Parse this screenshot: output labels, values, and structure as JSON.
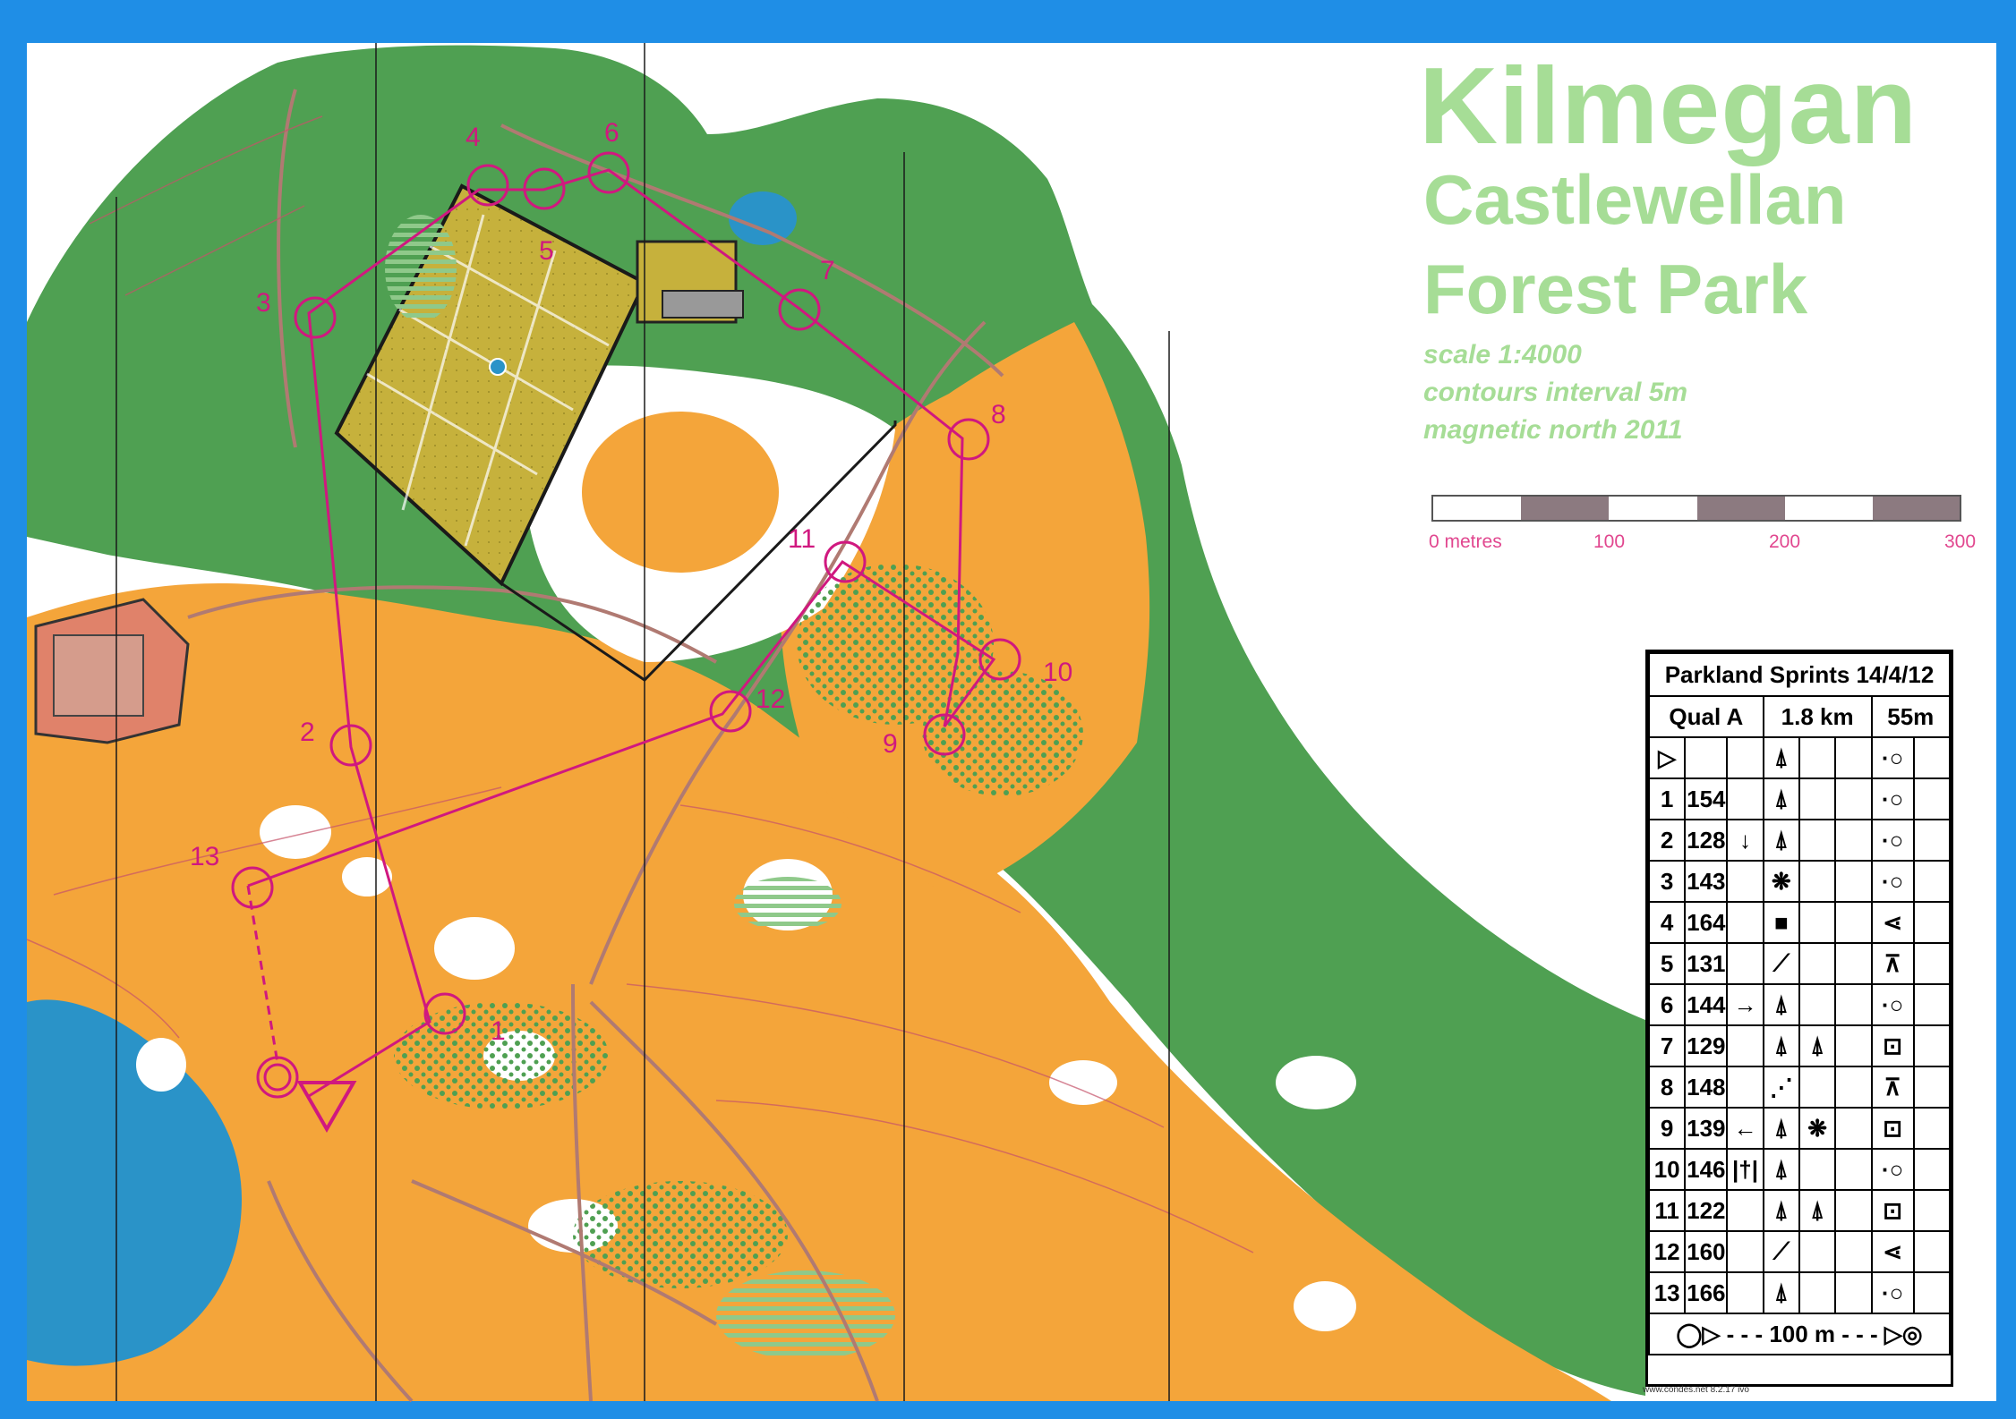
{
  "map": {
    "title_line1": "Kilmegan",
    "title_line2": "Castlewellan",
    "title_line3": "Forest Park",
    "scale": "scale 1:4000",
    "contours": "contours interval 5m",
    "magnetic": "magnetic north 2011",
    "scale_bar_labels": [
      "0 metres",
      "100",
      "200",
      "300"
    ],
    "credit": "www.condes.net 8.2.17 ivo",
    "colors": {
      "frame": "#1f8ee6",
      "forest_green": "#4fa052",
      "open_orange": "#f4a53a",
      "olive_private": "#c6b13c",
      "course_magenta": "#d0187f",
      "title_green": "#a6dd96",
      "water": "#2a93c8"
    }
  },
  "course": {
    "control_numbers": [
      "1",
      "2",
      "3",
      "4",
      "5",
      "6",
      "7",
      "8",
      "9",
      "10",
      "11",
      "12",
      "13"
    ]
  },
  "descriptions": {
    "title": "Parkland Sprints 14/4/12",
    "class": "Qual A",
    "length": "1.8 km",
    "climb": "55m",
    "start_symbol": "▷",
    "finish_row": "100 m",
    "rows": [
      {
        "num": "1",
        "code": "154",
        "dir": "",
        "feat": "tree-icon",
        "feat2": "",
        "loc": "control-circle-icon"
      },
      {
        "num": "2",
        "code": "128",
        "dir": "↓",
        "feat": "tree-icon",
        "feat2": "",
        "loc": "control-circle-icon"
      },
      {
        "num": "3",
        "code": "143",
        "dir": "",
        "feat": "thicket-icon",
        "feat2": "",
        "loc": "control-circle-icon"
      },
      {
        "num": "4",
        "code": "164",
        "dir": "",
        "feat": "boulder-square-icon",
        "feat2": "",
        "loc": "junction-icon"
      },
      {
        "num": "5",
        "code": "131",
        "dir": "",
        "feat": "path-icon",
        "feat2": "",
        "loc": "bend-icon"
      },
      {
        "num": "6",
        "code": "144",
        "dir": "→",
        "feat": "tree-icon",
        "feat2": "",
        "loc": "control-circle-icon"
      },
      {
        "num": "7",
        "code": "129",
        "dir": "",
        "feat": "tree-icon",
        "feat2": "tree-icon",
        "loc": "between-icon"
      },
      {
        "num": "8",
        "code": "148",
        "dir": "",
        "feat": "track-icon",
        "feat2": "",
        "loc": "bend-icon"
      },
      {
        "num": "9",
        "code": "139",
        "dir": "←",
        "feat": "tree-icon",
        "feat2": "thicket-icon",
        "loc": "between-icon"
      },
      {
        "num": "10",
        "code": "146",
        "dir": "|†|",
        "feat": "tree-icon",
        "feat2": "",
        "loc": "control-circle-icon"
      },
      {
        "num": "11",
        "code": "122",
        "dir": "",
        "feat": "tree-icon",
        "feat2": "tree-icon",
        "loc": "between-icon"
      },
      {
        "num": "12",
        "code": "160",
        "dir": "",
        "feat": "path-icon",
        "feat2": "",
        "loc": "junction-icon"
      },
      {
        "num": "13",
        "code": "166",
        "dir": "",
        "feat": "tree-icon",
        "feat2": "",
        "loc": "control-circle-icon"
      }
    ]
  }
}
